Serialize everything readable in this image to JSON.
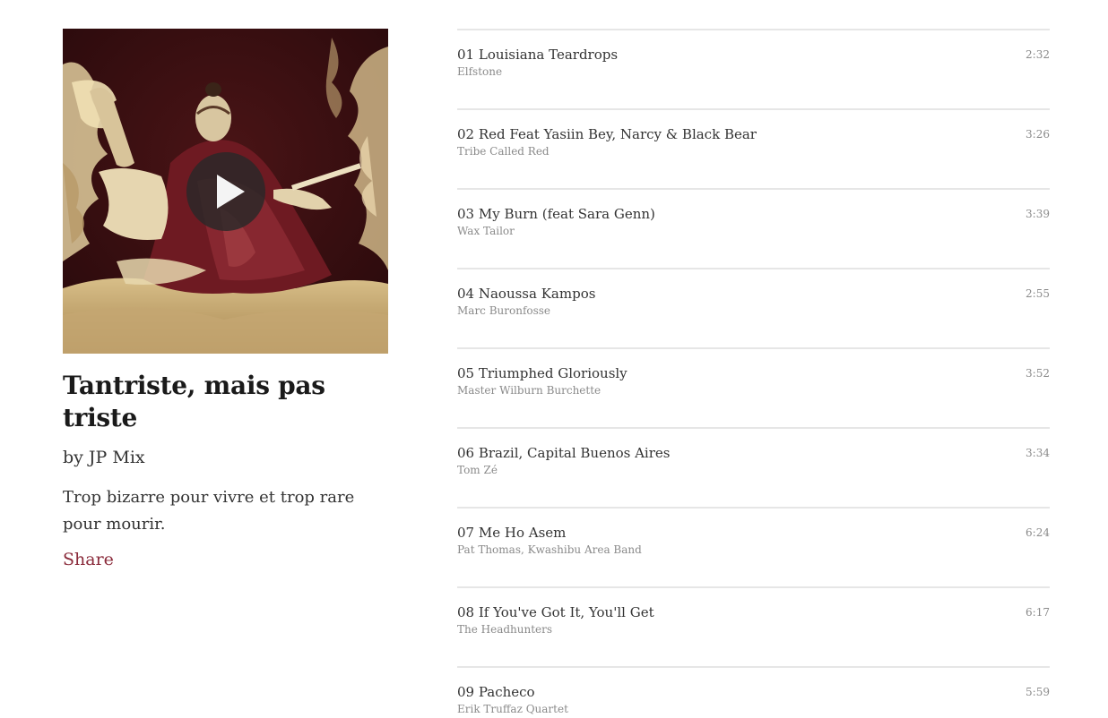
{
  "mix": {
    "title": "Tantriste, mais pas triste",
    "by": "by JP Mix",
    "description": "Trop bizarre pour vivre et trop rare pour mourir.",
    "share_label": "Share"
  },
  "colors": {
    "accent": "#8a2a3a",
    "divider": "#e6e6e6",
    "muted_text": "#8a8a8a"
  },
  "tracks": [
    {
      "number_title": "01 Louisiana Teardrops",
      "artist": "Elfstone",
      "duration": "2:32"
    },
    {
      "number_title": "02 Red Feat Yasiin Bey, Narcy & Black Bear",
      "artist": "Tribe Called Red",
      "duration": "3:26"
    },
    {
      "number_title": "03 My Burn (feat Sara Genn)",
      "artist": "Wax Tailor",
      "duration": "3:39"
    },
    {
      "number_title": "04 Naoussa Kampos",
      "artist": "Marc Buronfosse",
      "duration": "2:55"
    },
    {
      "number_title": "05 Triumphed Gloriously",
      "artist": "Master Wilburn Burchette",
      "duration": "3:52"
    },
    {
      "number_title": "06 Brazil, Capital Buenos Aires",
      "artist": "Tom Zé",
      "duration": "3:34"
    },
    {
      "number_title": "07 Me Ho Asem",
      "artist": "Pat Thomas, Kwashibu Area Band",
      "duration": "6:24"
    },
    {
      "number_title": "08 If You've Got It, You'll Get",
      "artist": "The Headhunters",
      "duration": "6:17"
    },
    {
      "number_title": "09 Pacheco",
      "artist": "Erik Truffaz Quartet",
      "duration": "5:59"
    }
  ]
}
